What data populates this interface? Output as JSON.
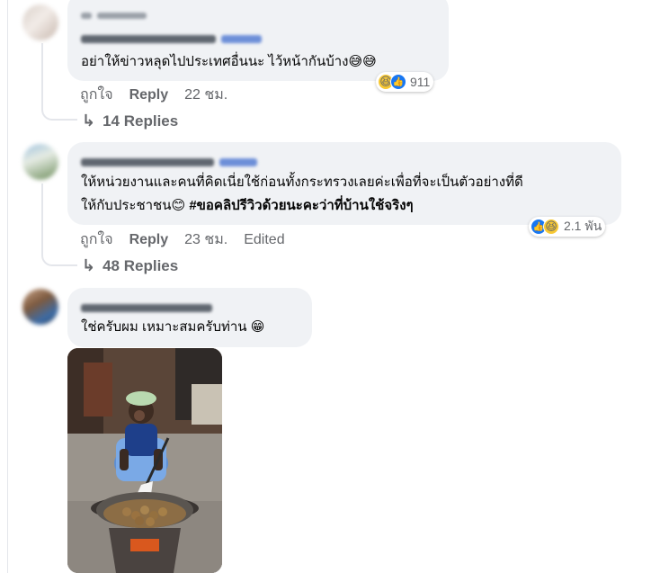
{
  "comments": [
    {
      "text": "อย่าให้ข่าวหลุดไปประเทศอื่นนะ ไว้หน้ากันบ้าง😅😅",
      "like_label": "ถูกใจ",
      "reply_label": "Reply",
      "time": "22 ชม.",
      "reaction_count": "911",
      "reaction_icons": [
        "haha-emoji",
        "like-icon"
      ],
      "replies_label": "14 Replies"
    },
    {
      "text_line1": "ให้หน่วยงานและคนที่คิดเนี่ยใช้ก่อนทั้งกระทรวงเลยค่ะเพื่อที่จะเป็นตัวอย่างที่ดี",
      "text_line2_plain": "ให้กับประชาชน😊",
      "text_line2_hashtag": "#ขอคลิปรีวิวด้วยนะคะว่าที่บ้านใช้จริงๆ",
      "like_label": "ถูกใจ",
      "reply_label": "Reply",
      "time": "23 ชม.",
      "edited_label": "Edited",
      "reaction_count": "2.1 พัน",
      "reaction_icons": [
        "like-icon",
        "haha-emoji"
      ],
      "replies_label": "48 Replies"
    },
    {
      "text": "ใช่ครับผม เหมาะสมครับท่าน 😁"
    }
  ],
  "colors": {
    "bubble_bg": "#f0f2f5",
    "meta_text": "#65676b",
    "like_blue": "#1877f2",
    "haha_yellow": "#f7c833"
  }
}
